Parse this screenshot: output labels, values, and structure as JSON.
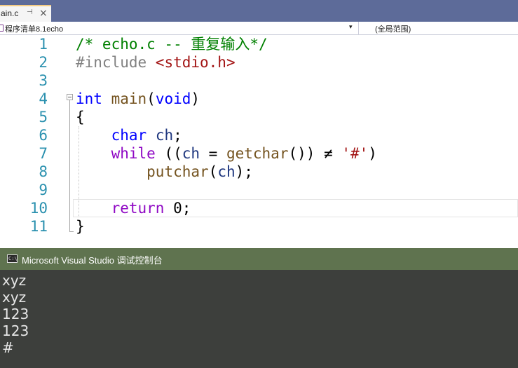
{
  "tabs": [
    {
      "label": "ain.c",
      "pin_glyph": "⊣",
      "close_glyph": "×"
    }
  ],
  "navbar": {
    "project": "程序清单8.1echo",
    "dropdown_glyph": "▾",
    "scope": "(全局范围)"
  },
  "editor": {
    "line_numbers": [
      "1",
      "2",
      "3",
      "4",
      "5",
      "6",
      "7",
      "8",
      "9",
      "10",
      "11"
    ],
    "lines": [
      {
        "segments": [
          {
            "cls": "c-comment",
            "text": "/* echo.c -- 重复输入*/"
          }
        ]
      },
      {
        "segments": [
          {
            "cls": "c-pre",
            "text": "#include "
          },
          {
            "cls": "c-str",
            "text": "<stdio.h>"
          }
        ]
      },
      {
        "segments": []
      },
      {
        "segments": [
          {
            "cls": "c-kw",
            "text": "int"
          },
          {
            "cls": "c-op",
            "text": " "
          },
          {
            "cls": "c-fn",
            "text": "main"
          },
          {
            "cls": "c-op",
            "text": "("
          },
          {
            "cls": "c-kw",
            "text": "void"
          },
          {
            "cls": "c-op",
            "text": ")"
          }
        ]
      },
      {
        "segments": [
          {
            "cls": "c-op",
            "text": "{"
          }
        ]
      },
      {
        "segments": [
          {
            "cls": "c-op",
            "text": "    "
          },
          {
            "cls": "c-kw",
            "text": "char"
          },
          {
            "cls": "c-op",
            "text": " "
          },
          {
            "cls": "c-var",
            "text": "ch"
          },
          {
            "cls": "c-op",
            "text": ";"
          }
        ]
      },
      {
        "segments": [
          {
            "cls": "c-op",
            "text": "    "
          },
          {
            "cls": "c-flow",
            "text": "while"
          },
          {
            "cls": "c-op",
            "text": " (("
          },
          {
            "cls": "c-var",
            "text": "ch"
          },
          {
            "cls": "c-op",
            "text": " = "
          },
          {
            "cls": "c-fn",
            "text": "getchar"
          },
          {
            "cls": "c-op",
            "text": "()) ≠ "
          },
          {
            "cls": "c-str",
            "text": "'#'"
          },
          {
            "cls": "c-op",
            "text": ")"
          }
        ]
      },
      {
        "segments": [
          {
            "cls": "c-op",
            "text": "        "
          },
          {
            "cls": "c-fn",
            "text": "putchar"
          },
          {
            "cls": "c-op",
            "text": "("
          },
          {
            "cls": "c-var",
            "text": "ch"
          },
          {
            "cls": "c-op",
            "text": ");"
          }
        ]
      },
      {
        "segments": []
      },
      {
        "segments": [
          {
            "cls": "c-op",
            "text": "    "
          },
          {
            "cls": "c-flow",
            "text": "return"
          },
          {
            "cls": "c-op",
            "text": " 0;"
          }
        ]
      },
      {
        "segments": [
          {
            "cls": "c-op",
            "text": "}"
          }
        ]
      }
    ]
  },
  "console": {
    "icon_text": "C:\\",
    "title": "Microsoft Visual Studio 调试控制台",
    "output": [
      "xyz",
      "xyz",
      "123",
      "123",
      "#"
    ]
  }
}
